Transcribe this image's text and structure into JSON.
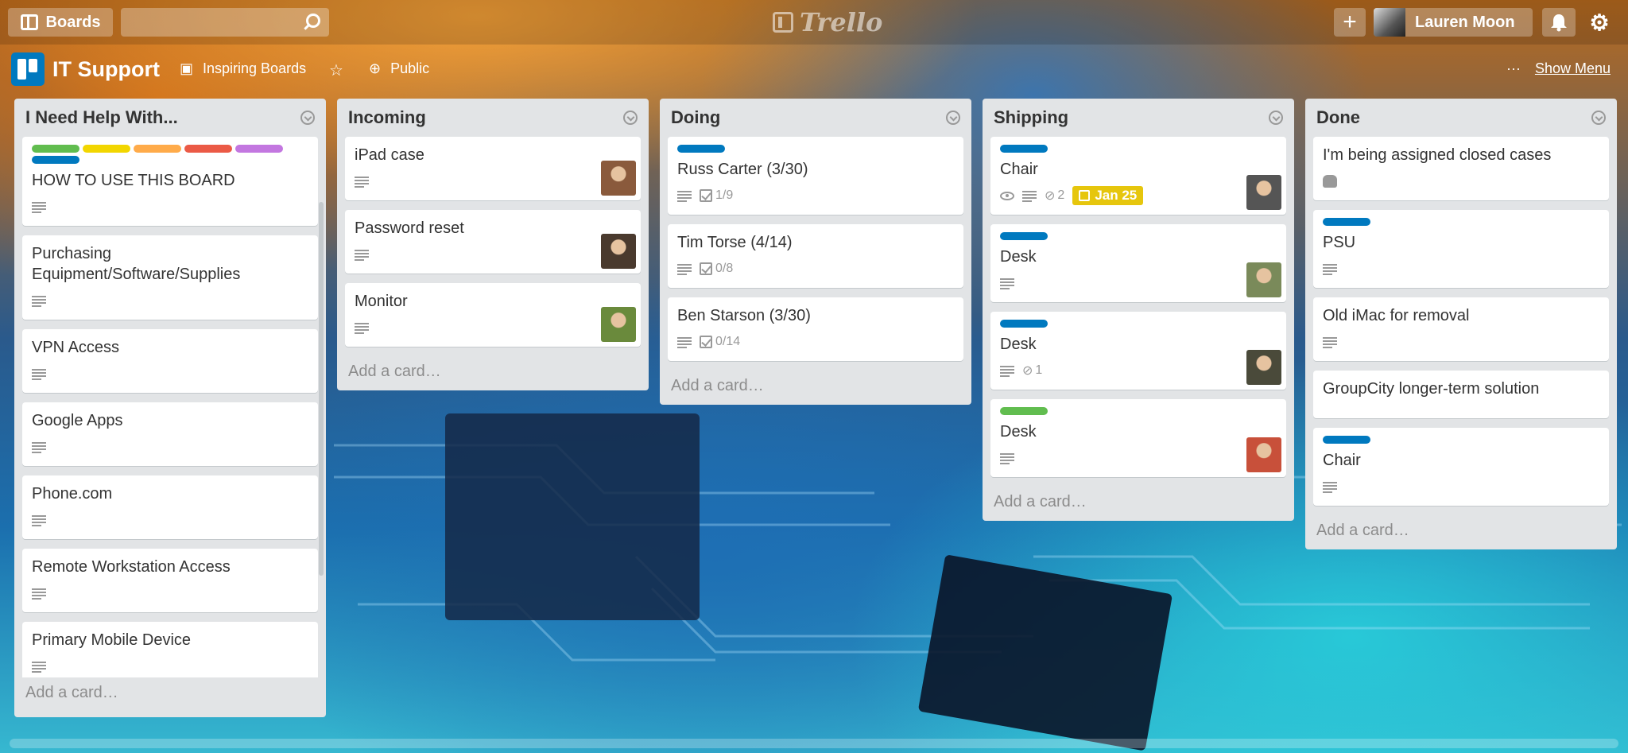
{
  "topbar": {
    "boards_label": "Boards",
    "search_value": "",
    "logo_text": "Trello",
    "user_name": "Lauren Moon"
  },
  "board": {
    "title": "IT Support",
    "org": "Inspiring Boards",
    "visibility": "Public",
    "more": "···",
    "show_menu": "Show Menu"
  },
  "colors": {
    "green": "#61bd4f",
    "yellow": "#f2d600",
    "orange": "#ffab4a",
    "red": "#eb5a46",
    "purple": "#c377e0",
    "blue": "#0079bf",
    "due": "#e6c60d"
  },
  "lists": [
    {
      "title": "I Need Help With...",
      "add_card": "Add a card…",
      "cards": [
        {
          "labels": [
            "#61bd4f",
            "#f2d600",
            "#ffab4a",
            "#eb5a46",
            "#c377e0",
            "#0079bf"
          ],
          "title": "HOW TO USE THIS BOARD",
          "desc": true
        },
        {
          "title": "Purchasing Equipment/Software/Supplies",
          "desc": true
        },
        {
          "title": "VPN Access",
          "desc": true
        },
        {
          "title": "Google Apps",
          "desc": true
        },
        {
          "title": "Phone.com",
          "desc": true
        },
        {
          "title": "Remote Workstation Access",
          "desc": true
        },
        {
          "title": "Primary Mobile Device",
          "desc": true
        }
      ]
    },
    {
      "title": "Incoming",
      "add_card": "Add a card…",
      "cards": [
        {
          "title": "iPad case",
          "desc": true,
          "member": "#8a5a3c"
        },
        {
          "title": "Password reset",
          "desc": true,
          "member": "#4a3a2e"
        },
        {
          "title": "Monitor",
          "desc": true,
          "member": "#6a8a3c"
        }
      ]
    },
    {
      "title": "Doing",
      "add_card": "Add a card…",
      "cards": [
        {
          "labels": [
            "#0079bf"
          ],
          "title": "Russ Carter (3/30)",
          "desc": true,
          "checklist": "1/9"
        },
        {
          "title": "Tim Torse (4/14)",
          "desc": true,
          "checklist": "0/8"
        },
        {
          "title": "Ben Starson (3/30)",
          "desc": true,
          "checklist": "0/14"
        }
      ]
    },
    {
      "title": "Shipping",
      "add_card": "Add a card…",
      "cards": [
        {
          "labels": [
            "#0079bf"
          ],
          "title": "Chair",
          "watch": true,
          "desc": true,
          "attachments": "2",
          "due": "Jan 25",
          "member": "#555555"
        },
        {
          "labels": [
            "#0079bf"
          ],
          "title": "Desk",
          "desc": true,
          "member": "#7a8a5a"
        },
        {
          "labels": [
            "#0079bf"
          ],
          "title": "Desk",
          "desc": true,
          "attachments": "1",
          "member": "#4a4a3a"
        },
        {
          "labels": [
            "#61bd4f"
          ],
          "title": "Desk",
          "desc": true,
          "member": "#c8503a"
        }
      ]
    },
    {
      "title": "Done",
      "add_card": "Add a card…",
      "cards": [
        {
          "title": "I'm being assigned closed cases",
          "puzzle": true
        },
        {
          "labels": [
            "#0079bf"
          ],
          "title": "PSU",
          "desc": true
        },
        {
          "title": "Old iMac for removal",
          "desc": true
        },
        {
          "title": "GroupCity longer-term solution"
        },
        {
          "labels": [
            "#0079bf"
          ],
          "title": "Chair",
          "desc": true
        }
      ]
    }
  ]
}
